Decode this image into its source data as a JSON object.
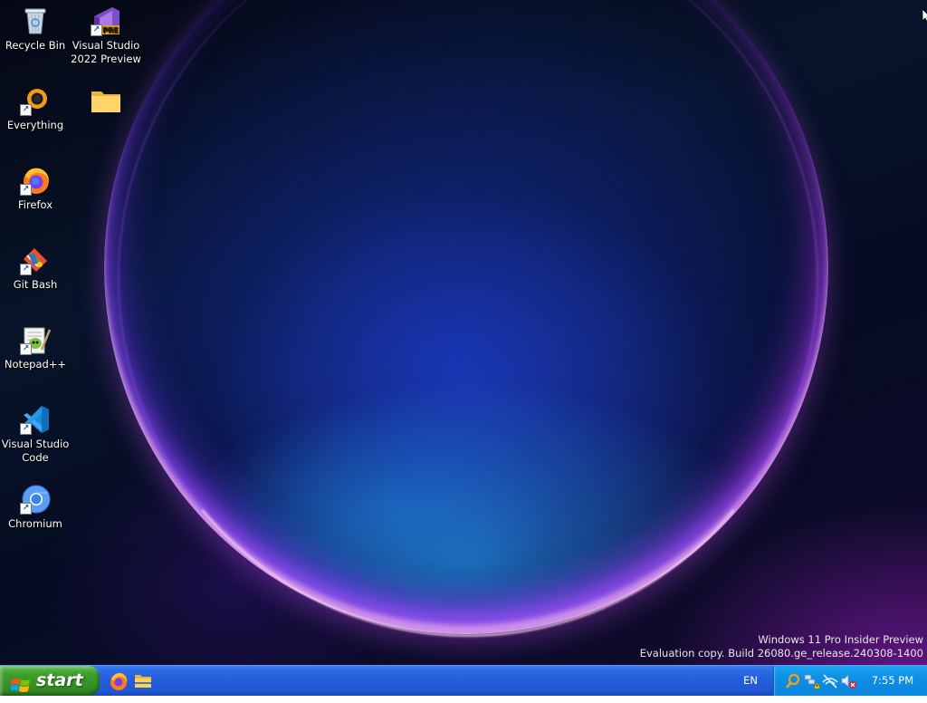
{
  "desktop": {
    "icons": [
      {
        "label": "Recycle Bin",
        "icon": "recycle-bin-icon"
      },
      {
        "label": "Visual Studio 2022 Preview",
        "icon": "visual-studio-preview-icon",
        "badge": "PRE"
      },
      {
        "label": "Everything",
        "icon": "everything-icon"
      },
      {
        "label": "",
        "icon": "folder-icon"
      },
      {
        "label": "Firefox",
        "icon": "firefox-icon"
      },
      {
        "label": "Git Bash",
        "icon": "git-bash-icon"
      },
      {
        "label": "Notepad++",
        "icon": "notepad-plus-plus-icon"
      },
      {
        "label": "Visual Studio Code",
        "icon": "vscode-icon"
      },
      {
        "label": "Chromium",
        "icon": "chromium-icon"
      }
    ],
    "watermark": {
      "line1": "Windows 11 Pro Insider Preview",
      "line2": "Evaluation copy. Build 26080.ge_release.240308-1400"
    }
  },
  "taskbar": {
    "start_label": "start",
    "quick_launch": [
      "firefox-icon",
      "file-explorer-icon"
    ],
    "language": "EN",
    "tray_icons": [
      "search-icon",
      "network-warning-icon",
      "network-disconnected-icon",
      "volume-muted-icon"
    ],
    "clock": "7:55 PM"
  },
  "colors": {
    "taskbar_blue": "#245edb",
    "start_green": "#3c9e2b",
    "tray_blue": "#0f8fe5"
  }
}
